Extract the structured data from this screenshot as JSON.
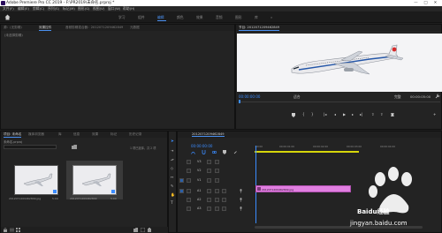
{
  "titlebar": {
    "title": "Adobe Premiere Pro CC 2019 - F:\\PR2019\\未命名.prproj *",
    "minimize": "—",
    "maximize": "□",
    "close": "✕"
  },
  "menubar": {
    "items": [
      "文件(F)",
      "编辑(E)",
      "剪辑(C)",
      "序列(S)",
      "标记(M)",
      "图形(G)",
      "视图(V)",
      "窗口(W)",
      "帮助(H)"
    ]
  },
  "workspaces": {
    "items": [
      "学习",
      "组件",
      "编辑",
      "颜色",
      "效果",
      "音频",
      "图形",
      "库"
    ],
    "active_index": 2,
    "more": "»"
  },
  "source_panel": {
    "tabs": [
      "源：(无剪辑)",
      "效果控件",
      "音频剪辑混合器：2012071209462849",
      "元数据"
    ],
    "active_tab": 1,
    "empty_text": "(未选择剪辑)"
  },
  "program_panel": {
    "tab": "节目: 2012071209462849",
    "timecode": "00:00:00:00",
    "fit": "适合",
    "quality": "完整",
    "duration": "00:00:05:00"
  },
  "project_panel": {
    "tabs": [
      "项目: 未命名",
      "媒体浏览器",
      "库",
      "信息",
      "效果",
      "标记",
      "历史记录"
    ],
    "active_tab": 0,
    "project_file": "未命名.prproj",
    "item_count": "1 项已选择，共 2 项",
    "items": [
      {
        "name": "2012071209462849.jpg",
        "duration": "5:00"
      },
      {
        "name": "2012071209462849",
        "duration": "5:00"
      }
    ]
  },
  "timeline_panel": {
    "tab": "2012071209462849",
    "timecode": "00:00:00:00",
    "ruler": [
      ":00:00",
      "00:00:01:00",
      "00:00:02:00",
      "00:00:03:00",
      "00:00:04:00"
    ],
    "tracks": [
      "V3",
      "V2",
      "V1",
      "A1",
      "A2",
      "A3"
    ],
    "clip_label": "2012071209462849.jpg"
  },
  "watermark": {
    "brand": "Baidu经验",
    "url": "jingyan.baidu.com"
  },
  "colors": {
    "accent": "#4a90f0",
    "clip": "#e07fe0",
    "playhead": "#3b8cff"
  }
}
